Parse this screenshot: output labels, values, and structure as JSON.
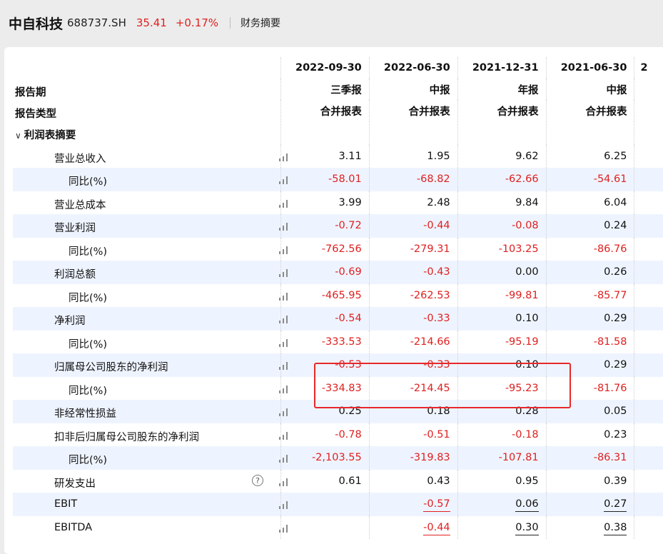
{
  "header": {
    "stock_name": "中自科技",
    "stock_code": "688737.SH",
    "price": "35.41",
    "change": "+0.17%",
    "section_title": "财务摘要"
  },
  "colors": {
    "negative": "#e02020",
    "highlight_border": "#e8282a",
    "row_alt": "#eef4ff"
  },
  "table": {
    "header_rows": [
      {
        "label": "",
        "values": [
          "2022-09-30",
          "2022-06-30",
          "2021-12-31",
          "2021-06-30"
        ],
        "cut": "2"
      },
      {
        "label": "报告期",
        "values": [
          "三季报",
          "中报",
          "年报",
          "中报"
        ]
      },
      {
        "label": "报告类型",
        "values": [
          "合并报表",
          "合并报表",
          "合并报表",
          "合并报表"
        ]
      }
    ],
    "section": {
      "label": "利润表摘要",
      "icon": "chevron-down-icon"
    },
    "rows": [
      {
        "label": "营业总收入",
        "values": [
          "3.11",
          "1.95",
          "9.62",
          "6.25"
        ]
      },
      {
        "label": "同比(%)",
        "values": [
          "-58.01",
          "-68.82",
          "-62.66",
          "-54.61"
        ]
      },
      {
        "label": "营业总成本",
        "values": [
          "3.99",
          "2.48",
          "9.84",
          "6.04"
        ]
      },
      {
        "label": "营业利润",
        "values": [
          "-0.72",
          "-0.44",
          "-0.08",
          "0.24"
        ]
      },
      {
        "label": "同比(%)",
        "values": [
          "-762.56",
          "-279.31",
          "-103.25",
          "-86.76"
        ]
      },
      {
        "label": "利润总额",
        "values": [
          "-0.69",
          "-0.43",
          "0.00",
          "0.26"
        ]
      },
      {
        "label": "同比(%)",
        "values": [
          "-465.95",
          "-262.53",
          "-99.81",
          "-85.77"
        ]
      },
      {
        "label": "净利润",
        "values": [
          "-0.54",
          "-0.33",
          "0.10",
          "0.29"
        ]
      },
      {
        "label": "同比(%)",
        "values": [
          "-333.53",
          "-214.66",
          "-95.19",
          "-81.58"
        ]
      },
      {
        "label": "归属母公司股东的净利润",
        "values": [
          "-0.53",
          "-0.33",
          "0.10",
          "0.29"
        ]
      },
      {
        "label": "同比(%)",
        "values": [
          "-334.83",
          "-214.45",
          "-95.23",
          "-81.76"
        ]
      },
      {
        "label": "非经常性损益",
        "values": [
          "0.25",
          "0.18",
          "0.28",
          "0.05"
        ]
      },
      {
        "label": "扣非后归属母公司股东的净利润",
        "values": [
          "-0.78",
          "-0.51",
          "-0.18",
          "0.23"
        ]
      },
      {
        "label": "同比(%)",
        "values": [
          "-2,103.55",
          "-319.83",
          "-107.81",
          "-86.31"
        ]
      },
      {
        "label": "研发支出",
        "values": [
          "0.61",
          "0.43",
          "0.95",
          "0.39"
        ],
        "help_icon": "?"
      },
      {
        "label": "EBIT",
        "values": [
          "",
          "-0.57",
          "0.06",
          "0.27"
        ]
      },
      {
        "label": "EBITDA",
        "values": [
          "",
          "-0.44",
          "0.30",
          "0.38"
        ]
      }
    ]
  }
}
